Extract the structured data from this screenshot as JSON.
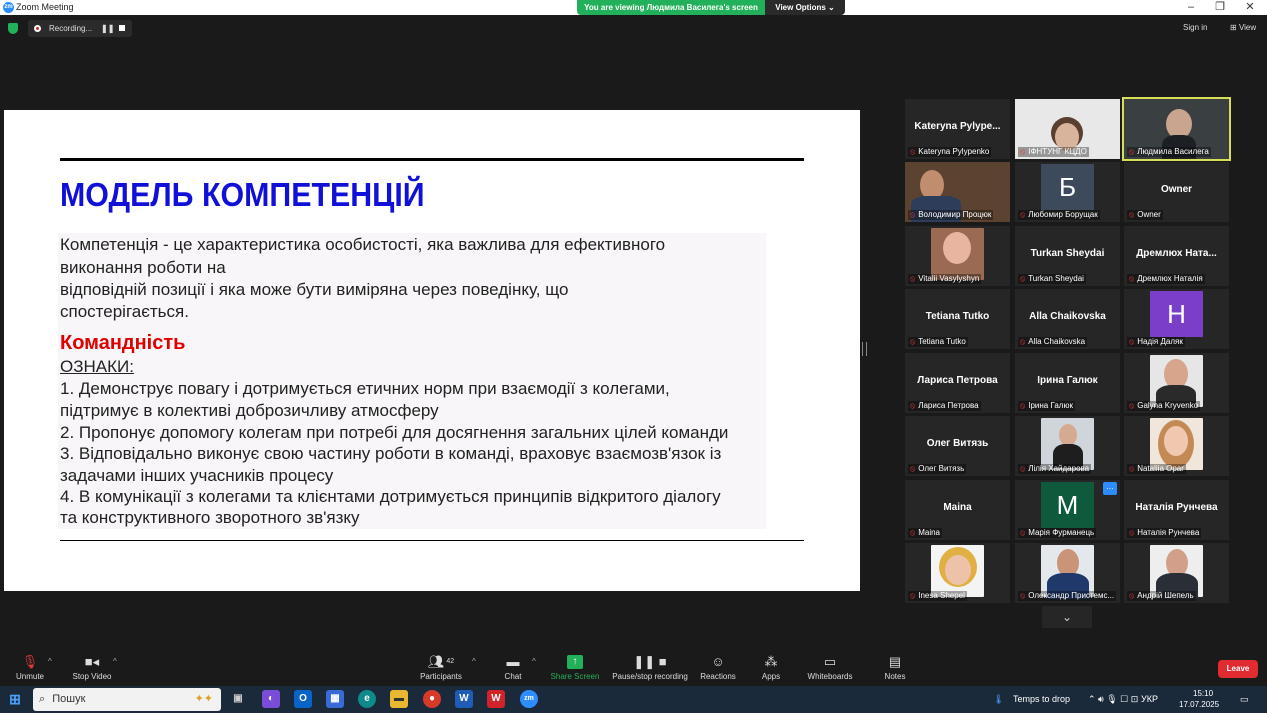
{
  "window": {
    "title": "Zoom Meeting"
  },
  "banner": {
    "viewing": "You are viewing Людмила Василега's screen",
    "view_options": "View Options"
  },
  "recording": {
    "label": "Recording...",
    "pause": "❚❚"
  },
  "top_right": {
    "sign_in": "Sign in",
    "view": "View"
  },
  "slide": {
    "title": "МОДЕЛЬ КОМПЕТЕНЦІЙ",
    "def_line1": "Компетенція - це характеристика особистості, яка важлива для ефективного",
    "def_line2": "виконання роботи на",
    "def_line3": "відповідній позиції і яка може бути виміряна через поведінку, що",
    "def_line4": "спостерігається.",
    "heading": "Командність",
    "signs": "ОЗНАКИ:",
    "item1a": " 1. Демонструє повагу і дотримується етичних норм при взаємодії з колегами,",
    "item1b": "підтримує в колективі доброзичливу атмосферу",
    "item2": "2. Пропонує допомогу колегам при потребі для досягнення загальних цілей команди",
    "item3a": "3. Відповідально виконує свою частину роботи в команді, враховує взаємозв'язок із",
    "item3b": "задачами інших учасників процесу",
    "item4a": "4. В комунікації з колегами та клієнтами дотримується принципів відкритого діалогу",
    "item4b": "та конструктивного зворотного зв'язку"
  },
  "participants": [
    {
      "big": "Kateryna  Pylype...",
      "name": "Kateryna Pylypenko"
    },
    {
      "big": "",
      "name": "ІФНТУНГ КЦДО"
    },
    {
      "big": "",
      "name": "Людмила Василега"
    },
    {
      "big": "",
      "name": "Володимир Процюк"
    },
    {
      "big": "",
      "name": "Любомир Борущак",
      "avatar": "Б",
      "color": "#3c4a5c"
    },
    {
      "big": "Owner",
      "name": "Owner"
    },
    {
      "big": "",
      "name": "Vitalii Vasylyshyn"
    },
    {
      "big": "Turkan Sheydai",
      "name": "Turkan Sheydai"
    },
    {
      "big": "Дремлюх  Ната...",
      "name": "Дремлюх Наталія"
    },
    {
      "big": "Tetiana Tutko",
      "name": "Tetiana Tutko"
    },
    {
      "big": "Alla Chaikovska",
      "name": "Alla Chaikovska"
    },
    {
      "big": "",
      "name": "Надія Даляк",
      "avatar": "H",
      "color": "#7b3ec9"
    },
    {
      "big": "Лариса Петрова",
      "name": "Лариса Петрова"
    },
    {
      "big": "Ірина Галюк",
      "name": "Ірина Галюк"
    },
    {
      "big": "",
      "name": "Galyna Kryvenko"
    },
    {
      "big": "Олег Витязь",
      "name": "Олег Витязь"
    },
    {
      "big": "",
      "name": "Лілія Хайдарова"
    },
    {
      "big": "",
      "name": "Nataliia Opar"
    },
    {
      "big": "Maina",
      "name": "Maina"
    },
    {
      "big": "",
      "name": "Марія Фурманець",
      "avatar": "M",
      "color": "#0f5a3c"
    },
    {
      "big": "Наталія Рунчева",
      "name": "Наталія Рунчева"
    },
    {
      "big": "",
      "name": "Inesa Shepel"
    },
    {
      "big": "",
      "name": "Олександр Пристемс..."
    },
    {
      "big": "",
      "name": "Андрій Шепель"
    }
  ],
  "toolbar": {
    "unmute": "Unmute",
    "stop_video": "Stop Video",
    "participants": "Participants",
    "participants_count": "42",
    "chat": "Chat",
    "share": "Share Screen",
    "pause_rec": "Pause/stop recording",
    "reactions": "Reactions",
    "apps": "Apps",
    "whiteboards": "Whiteboards",
    "notes": "Notes",
    "leave": "Leave"
  },
  "taskbar": {
    "search": "Пошук",
    "temps": "Temps to drop",
    "lang": "УКР",
    "time": "15:10",
    "date": "17.07.2025"
  },
  "colors": {
    "accent_green": "#23b05a",
    "slide_title": "#1010d8",
    "slide_heading": "#e00000",
    "leave": "#e02b30",
    "active_border": "#d6df56"
  }
}
